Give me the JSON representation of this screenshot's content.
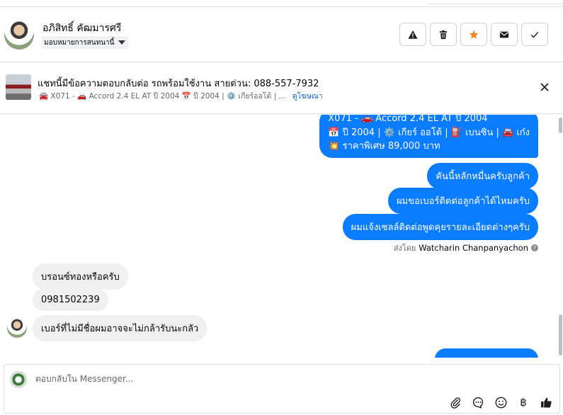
{
  "header": {
    "contact_name": "อภิสิทธิ์ คัฒมารศรี",
    "assign_label": "มอบหมายการสนทนานี้",
    "actions": [
      {
        "icon": "warning-icon",
        "label": "spam"
      },
      {
        "icon": "trash-icon",
        "label": "delete"
      },
      {
        "icon": "star-icon",
        "label": "star"
      },
      {
        "icon": "envelope-icon",
        "label": "unread"
      },
      {
        "icon": "check-icon",
        "label": "done"
      }
    ],
    "star_color": "#f5821f"
  },
  "ad": {
    "title": "แชทนี้มีข้อความตอบกลับต่อ รถพร้อมใช้งาน สายด่วน: 088-557-7932",
    "subtitle": "🚘 X071 - 🚗 Accord 2.4 EL AT ปี 2004 📅 ปี 2004 | ⚙️ เกียร์ออโต้ | ...",
    "link": "ดูโฆษณา"
  },
  "messages": {
    "car_line1": "X071 - 🚗 Accord 2.4 EL AT ปี 2004",
    "car_line2": "📅 ปี 2004 | ⚙️ เกียร์ ออโต้ | ⛽ เบนซิน | 🚘 เก๋ง",
    "car_line3": "💥 ราคาพิเศษ 89,000 บาท",
    "out2": "คันนี้หลักหมื่นครับลูกค้า",
    "out3": "ผมขอเบอร์ติดต่อลูกค้าได้ไหมครับ",
    "out4": "ผมแจ้งเซลล์ติดต่อพูดคุยรายละเอียดต่างๆครับ",
    "sent_by_prefix": "ส่งโดย",
    "sent_by_name": "Watcharin Chanpanyachon",
    "in1": "บรอนซ์ทองหรือครับ",
    "in2": "0981502239",
    "in3": "เบอร์ที่ไม่มีชื่อผมอาจจะไม่กล้ารับนะกลัว"
  },
  "composer": {
    "placeholder": "ตอบกลับใน Messenger...",
    "tools": [
      "paperclip-icon",
      "chat-bubble-icon",
      "emoji-icon",
      "baht-icon",
      "thumbs-up-icon"
    ],
    "baht_symbol": "฿"
  },
  "colors": {
    "outgoing_bubble": "#0a7cff",
    "incoming_bubble": "#f0f0f0",
    "link": "#0064d1"
  }
}
